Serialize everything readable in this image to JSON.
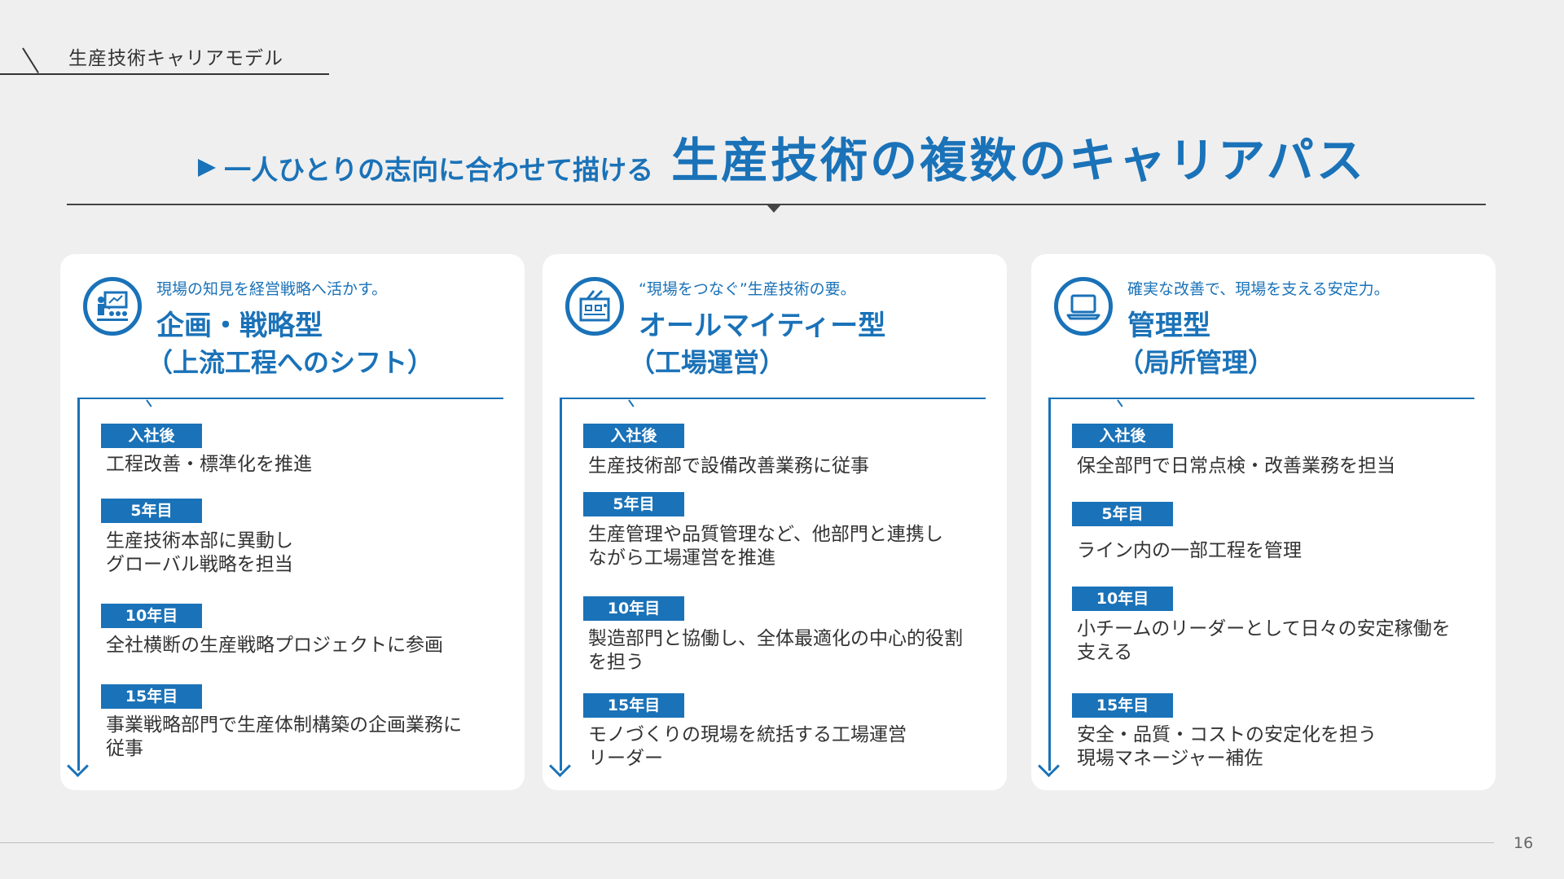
{
  "header": {
    "label": "生産技術キャリアモデル"
  },
  "headline": {
    "pre": "一人ひとりの志向に合わせて描ける",
    "main": "生産技術の複数のキャリアパス"
  },
  "cards": [
    {
      "icon": "presentation-icon",
      "tagline": "現場の知見を経営戦略へ活かす。",
      "title": "企画・戦略型",
      "subtitle": "（上流工程へのシフト）",
      "steps": [
        {
          "badge": "入社後",
          "text": "工程改善・標準化を推進"
        },
        {
          "badge": "5年目",
          "text": "生産技術本部に異動し\nグローバル戦略を担当"
        },
        {
          "badge": "10年目",
          "text": "全社横断の生産戦略プロジェクトに参画"
        },
        {
          "badge": "15年目",
          "text": "事業戦略部門で生産体制構築の企画業務に\n従事"
        }
      ]
    },
    {
      "icon": "factory-icon",
      "tagline": "“現場をつなぐ”生産技術の要。",
      "title": "オールマイティー型",
      "subtitle": "（工場運営）",
      "steps": [
        {
          "badge": "入社後",
          "text": "生産技術部で設備改善業務に従事"
        },
        {
          "badge": "5年目",
          "text": "生産管理や品質管理など、他部門と連携し\nながら工場運営を推進"
        },
        {
          "badge": "10年目",
          "text": "製造部門と協働し、全体最適化の中心的役割\nを担う"
        },
        {
          "badge": "15年目",
          "text": "モノづくりの現場を統括する工場運営\nリーダー"
        }
      ]
    },
    {
      "icon": "laptop-icon",
      "tagline": "確実な改善で、現場を支える安定力。",
      "title": "管理型",
      "subtitle": "（局所管理）",
      "steps": [
        {
          "badge": "入社後",
          "text": "保全部門で日常点検・改善業務を担当"
        },
        {
          "badge": "5年目",
          "text": "ライン内の一部工程を管理"
        },
        {
          "badge": "10年目",
          "text": "小チームのリーダーとして日々の安定稼働を\n支える"
        },
        {
          "badge": "15年目",
          "text": "安全・品質・コストの安定化を担う\n現場マネージャー補佐"
        }
      ]
    }
  ],
  "footer": {
    "page_number": "16"
  },
  "colors": {
    "accent": "#1a72b8",
    "background": "#efefef",
    "card": "#ffffff"
  }
}
